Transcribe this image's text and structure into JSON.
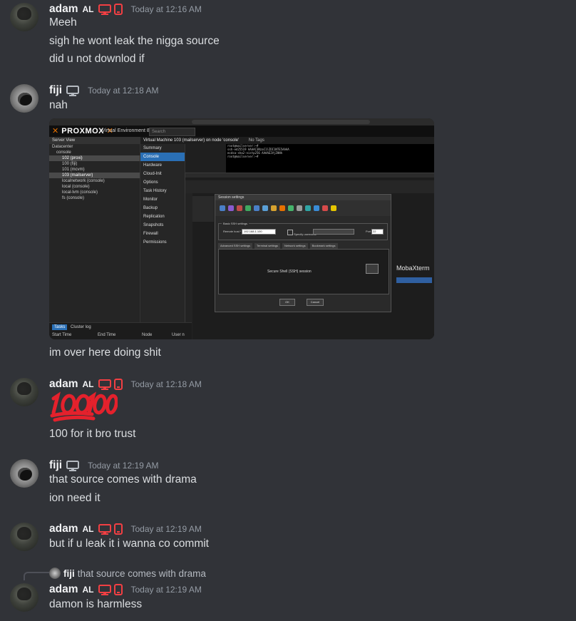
{
  "messages": [
    {
      "author": "adam",
      "tag": "AL",
      "timestamp": "Today at 12:16 AM",
      "lines": [
        "Meeh",
        "sigh he wont leak the nigga source",
        "did u not downlod if"
      ]
    },
    {
      "author": "fiji",
      "timestamp": "Today at 12:18 AM",
      "lines": [
        "nah"
      ],
      "attachment": {
        "brand": "PROXMOX",
        "subtitle": "Virtual Environment 8.3.0",
        "search_placeholder": "Search",
        "server_view": "Server View",
        "vm_title": "Virtual Machine 103 (mailserver) on node 'console'",
        "no_tags": "No Tags",
        "tree": [
          "Datacenter",
          "console",
          "102 (proxi)",
          "100 (fiji)",
          "101 (mcvm)",
          "103 (mailserver)",
          "localnetwork (console)",
          "local (console)",
          "local-lvm (console)",
          "fs (console)"
        ],
        "menu": [
          "Summary",
          "Console",
          "Hardware",
          "Cloud-Init",
          "Options",
          "Task History",
          "Monitor",
          "Backup",
          "Replication",
          "Snapshots",
          "Firewall",
          "Permissions"
        ],
        "bottom_tabs": [
          "Tasks",
          "Cluster log"
        ],
        "bottom_cols": [
          "Start Time",
          "End Time",
          "Node",
          "User n"
        ],
        "session_settings": "Session settings",
        "basic_ssh": "Basic SSH settings",
        "remote_host_label": "Remote host *",
        "remote_host_value": "192.168.1.100",
        "specify_username": "Specify username",
        "port_label": "Port",
        "port_value": "22",
        "ssh_tabs": [
          "Advanced SSH settings",
          "Terminal settings",
          "Network settings",
          "Bookmark settings"
        ],
        "secure_shell": "Secure Shell (SSH) session",
        "ok": "OK",
        "cancel": "Cancel",
        "mobaxterm": "MobaXterm"
      }
    },
    {
      "author": "fiji",
      "continuation": true,
      "lines": [
        "im over here doing shit"
      ]
    },
    {
      "author": "adam",
      "tag": "AL",
      "timestamp": "Today at 12:18 AM",
      "emoji": "💯",
      "lines": [
        "100 for it bro trust"
      ]
    },
    {
      "author": "fiji",
      "timestamp": "Today at 12:19 AM",
      "lines": [
        "that source comes with drama",
        "ion need it"
      ]
    },
    {
      "author": "adam",
      "tag": "AL",
      "timestamp": "Today at 12:19 AM",
      "lines": [
        "but if u leak it i wanna co commit"
      ]
    },
    {
      "author": "adam",
      "tag": "AL",
      "timestamp": "Today at 12:19 AM",
      "reply_to": {
        "author": "fiji",
        "text": "that source comes with drama"
      },
      "lines": [
        "damon is harmless"
      ]
    }
  ],
  "colors": {
    "background": "#313338",
    "username": "#f2f3f5",
    "text": "#dbdee1",
    "timestamp": "#949ba4",
    "role_icon_red": "#f23f43",
    "device_icon_grey": "#b5bac1",
    "emoji_red": "#e4212c"
  },
  "icons": [
    "desktop-icon",
    "mobile-icon"
  ]
}
